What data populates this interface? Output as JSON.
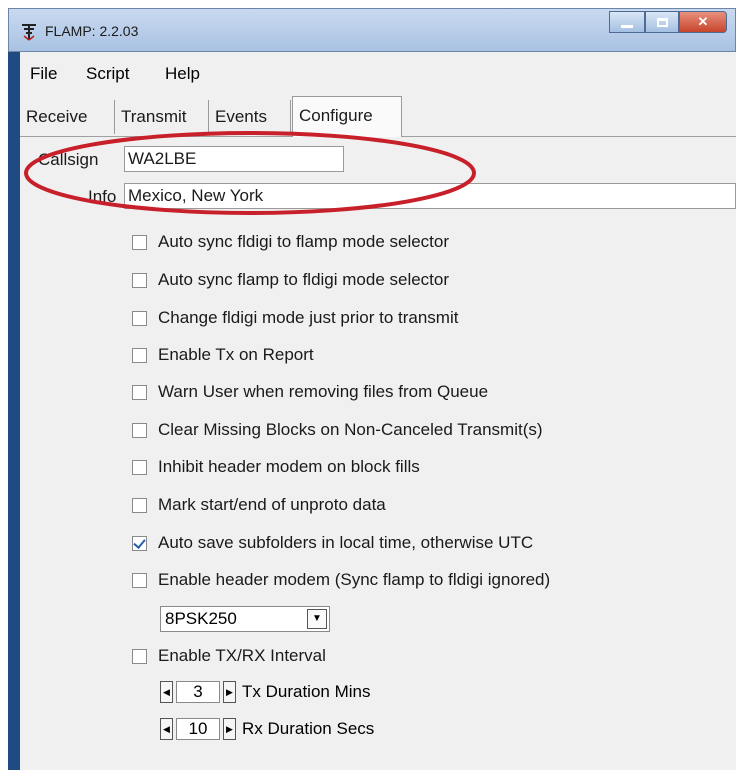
{
  "window": {
    "title": "FLAMP: 2.2.03"
  },
  "menu": [
    "File",
    "Script",
    "Help"
  ],
  "tabs": [
    "Receive",
    "Transmit",
    "Events",
    "Configure"
  ],
  "config": {
    "callsign_label": "Callsign",
    "callsign_value": "WA2LBE",
    "info_label": "Info",
    "info_value": "Mexico, New York"
  },
  "checkboxes": [
    {
      "label": "Auto sync fldigi to flamp mode selector",
      "checked": false
    },
    {
      "label": "Auto sync flamp to fldigi mode selector",
      "checked": false
    },
    {
      "label": "Change fldigi mode just prior to transmit",
      "checked": false
    },
    {
      "label": "Enable Tx on Report",
      "checked": false
    },
    {
      "label": "Warn User when removing files from Queue",
      "checked": false
    },
    {
      "label": "Clear Missing Blocks on Non-Canceled Transmit(s)",
      "checked": false
    },
    {
      "label": "Inhibit header modem on block fills",
      "checked": false
    },
    {
      "label": "Mark start/end of unproto data",
      "checked": false
    },
    {
      "label": "Auto save subfolders in local time, otherwise UTC",
      "checked": true
    },
    {
      "label": "Enable header modem (Sync flamp to fldigi ignored)",
      "checked": false
    },
    {
      "label": "Enable TX/RX Interval",
      "checked": false
    }
  ],
  "header_modem": {
    "selected": "8PSK250"
  },
  "intervals": {
    "tx_value": "3",
    "tx_label": "Tx Duration Mins",
    "rx_value": "10",
    "rx_label": "Rx Duration Secs"
  },
  "colors": {
    "annotation_oval": "#c8202a",
    "window_frame": "#1f4a82",
    "checkmark": "#2b5faa"
  }
}
